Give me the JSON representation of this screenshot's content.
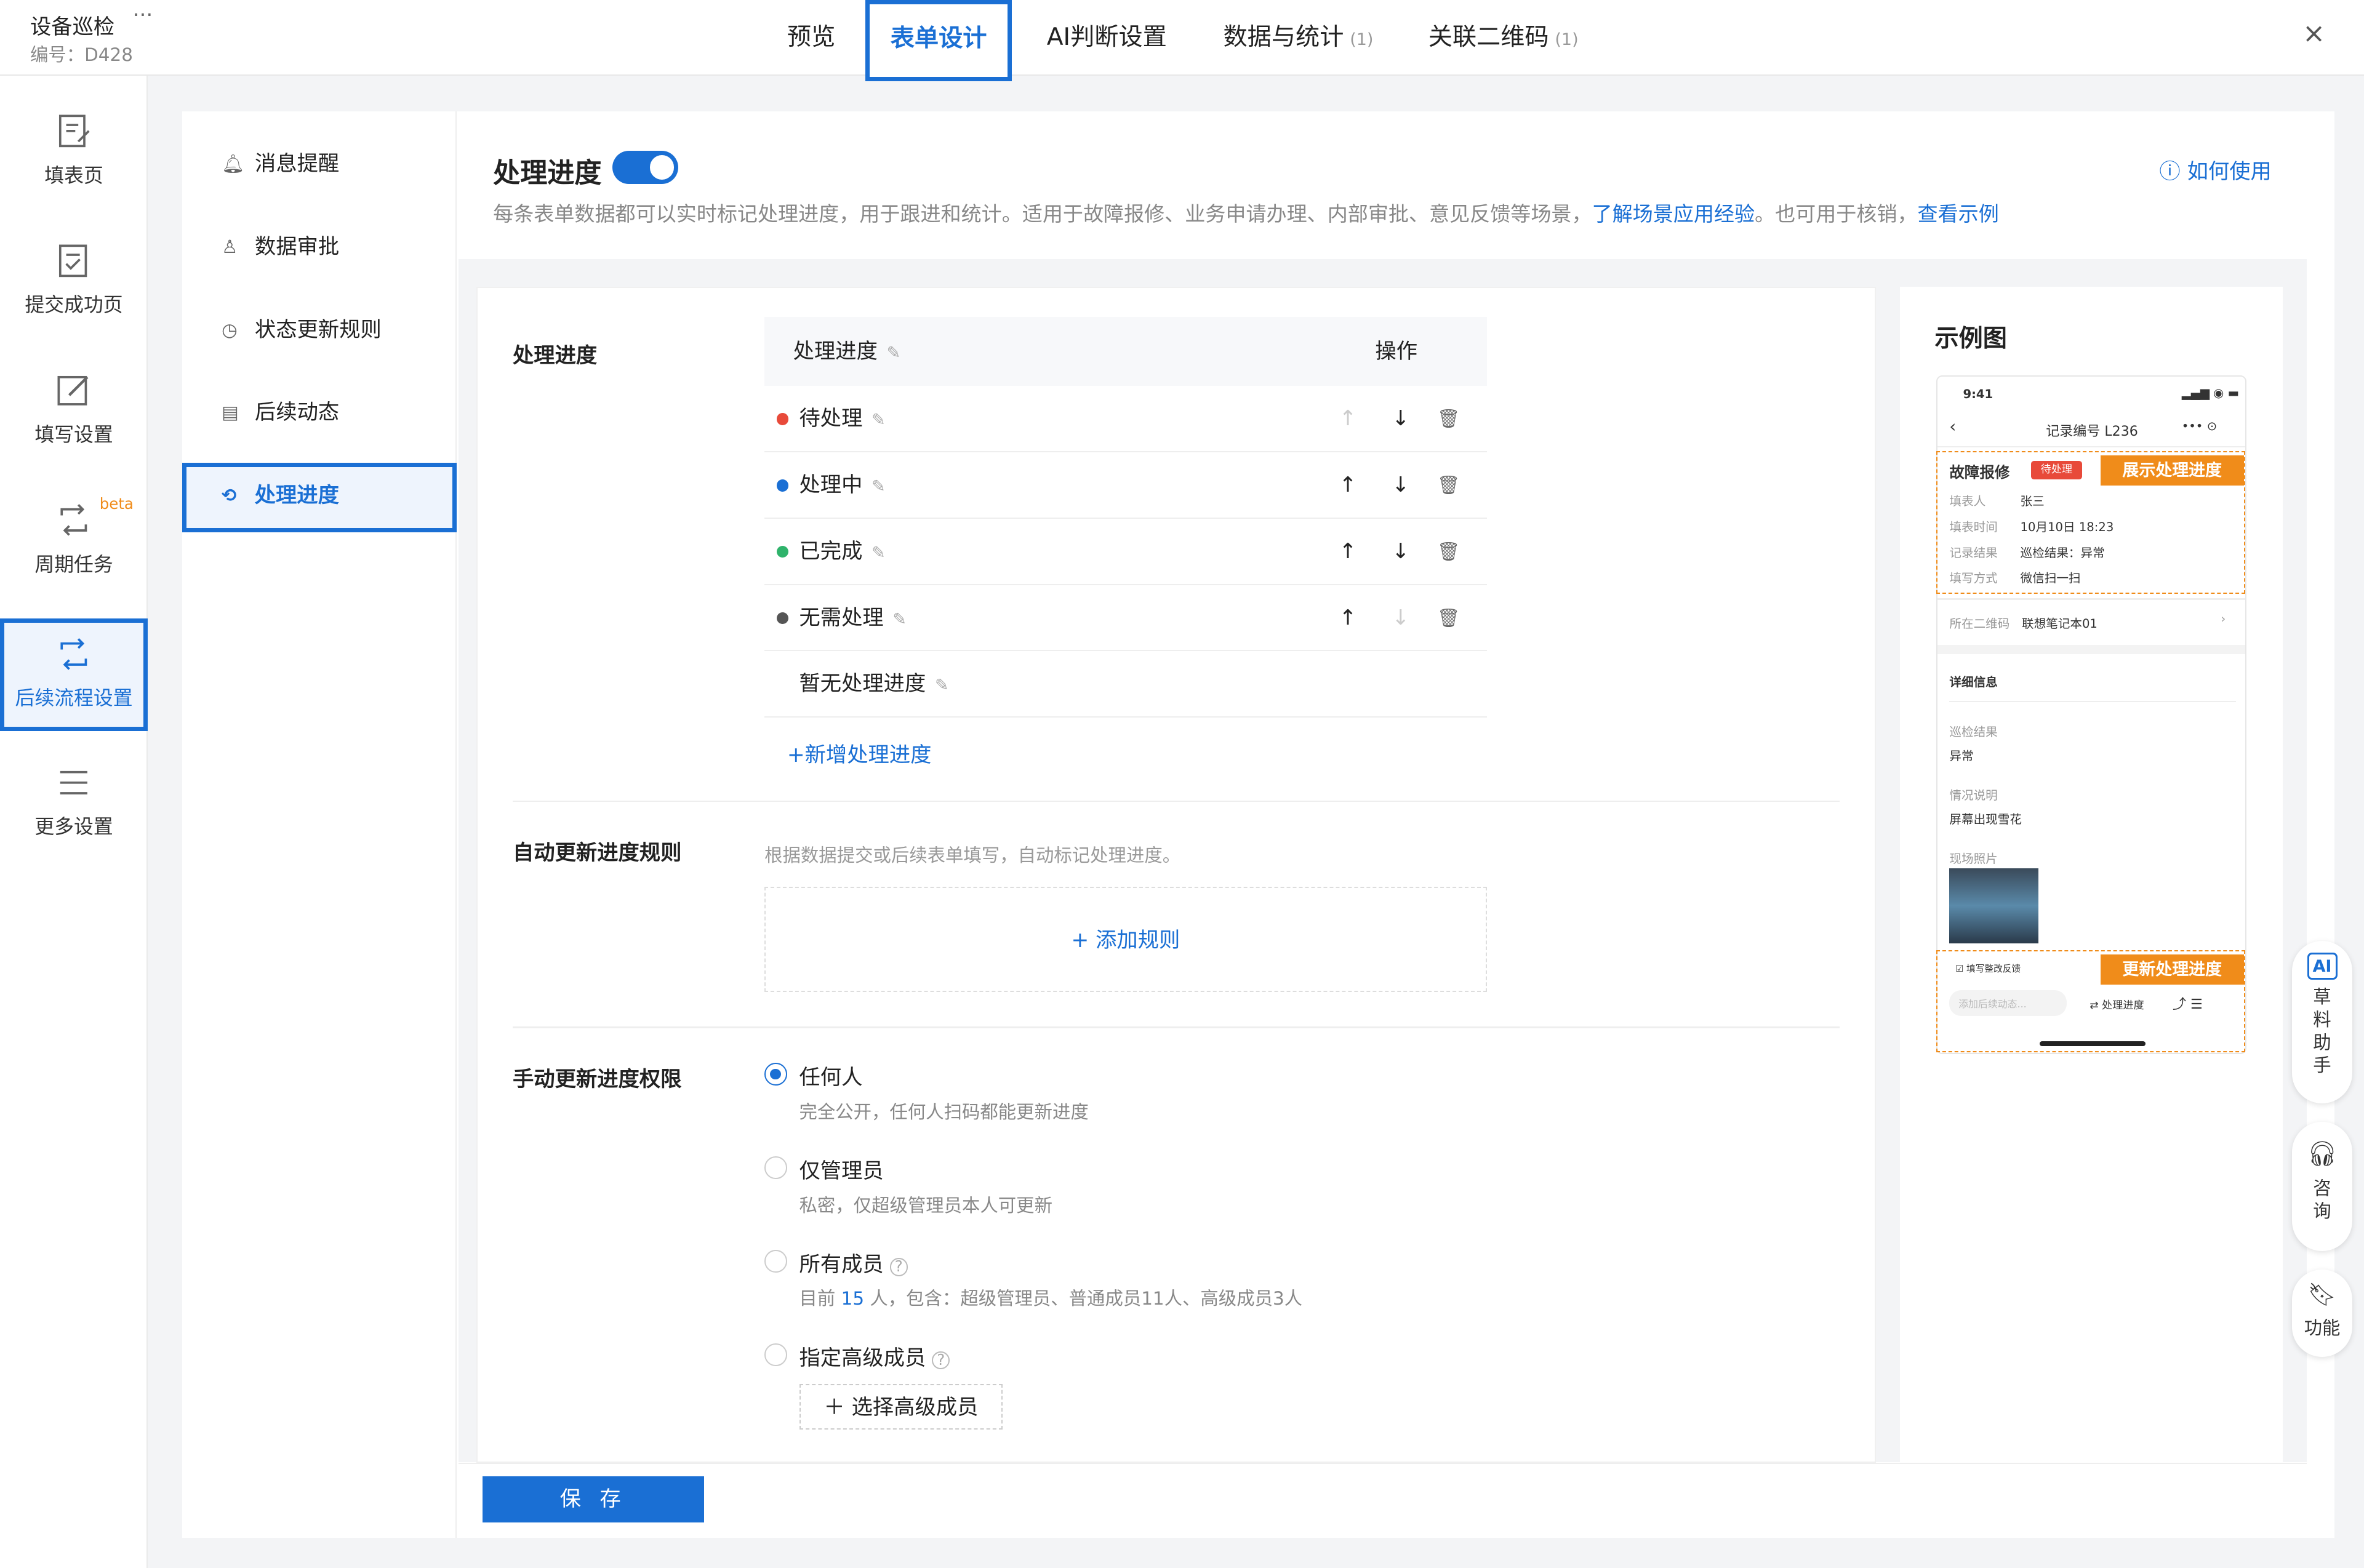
{
  "app": {
    "title": "设备巡检",
    "more": "···",
    "code": "编号：D428"
  },
  "tabs": [
    {
      "label": "预览",
      "count": ""
    },
    {
      "label": "表单设计",
      "count": ""
    },
    {
      "label": "AI判断设置",
      "count": ""
    },
    {
      "label": "数据与统计",
      "count": "(1)"
    },
    {
      "label": "关联二维码",
      "count": "(1)"
    }
  ],
  "close": "×",
  "leftnav": [
    {
      "label": "填表页"
    },
    {
      "label": "提交成功页"
    },
    {
      "label": "填写设置"
    },
    {
      "label": "周期任务",
      "badge": "beta"
    },
    {
      "label": "后续流程设置"
    },
    {
      "label": "更多设置"
    }
  ],
  "subnav": [
    {
      "label": "消息提醒",
      "icon": "bell-icon"
    },
    {
      "label": "数据审批",
      "icon": "stamp-icon"
    },
    {
      "label": "状态更新规则",
      "icon": "timer-icon"
    },
    {
      "label": "后续动态",
      "icon": "doc-icon"
    },
    {
      "label": "处理进度",
      "icon": "loop-icon"
    }
  ],
  "header": {
    "title": "处理进度",
    "howto": "如何使用",
    "desc_a": "每条表单数据都可以实时标记处理进度，用于跟进和统计。适用于故障报修、业务申请办理、内部审批、意见反馈等场景，",
    "desc_link1": "了解场景应用经验",
    "desc_b": "。也可用于核销，",
    "desc_link2": "查看示例"
  },
  "progress_section": {
    "label": "处理进度",
    "col_name": "处理进度",
    "col_op": "操作",
    "rows": [
      {
        "label": "待处理",
        "color": "#e84a3a"
      },
      {
        "label": "处理中",
        "color": "#1a6fd4"
      },
      {
        "label": "已完成",
        "color": "#2fb36b"
      },
      {
        "label": "无需处理",
        "color": "#555555"
      },
      {
        "label": "暂无处理进度",
        "color": ""
      }
    ],
    "add": "+新增处理进度"
  },
  "auto_section": {
    "label": "自动更新进度规则",
    "hint": "根据数据提交或后续表单填写，自动标记处理进度。",
    "add": "+ 添加规则"
  },
  "perm_section": {
    "label": "手动更新进度权限",
    "options": [
      {
        "label": "任何人",
        "sub": "完全公开，任何人扫码都能更新进度",
        "selected": true
      },
      {
        "label": "仅管理员",
        "sub": "私密，仅超级管理员本人可更新",
        "selected": false
      },
      {
        "label": "所有成员",
        "sub_a": "目前",
        "sub_num": "15",
        "sub_b": "人，包含：超级管理员、普通成员11人、高级成员3人",
        "selected": false
      },
      {
        "label": "指定高级成员",
        "selected": false
      }
    ],
    "select_btn": "选择高级成员"
  },
  "save": "保 存",
  "preview": {
    "title": "示例图",
    "time": "9:41",
    "record": "记录编号 L236",
    "card_title": "故障报修",
    "status_tag": "待处理",
    "show_tag": "展示处理进度",
    "fields": [
      {
        "k": "填表人",
        "v": "张三"
      },
      {
        "k": "填表时间",
        "v": "10月10日 18:23"
      },
      {
        "k": "记录结果",
        "v": "巡检结果：异常"
      },
      {
        "k": "填写方式",
        "v": "微信扫一扫"
      }
    ],
    "qr_k": "所在二维码",
    "qr_v": "联想笔记本01",
    "detail": "详细信息",
    "d1_k": "巡检结果",
    "d1_v": "异常",
    "d2_k": "情况说明",
    "d2_v": "屏幕出现雪花",
    "d3_k": "现场照片",
    "feedback": "填写整改反馈",
    "update_tag": "更新处理进度",
    "dynamic": "添加后续动态...",
    "progress_btn": "处理进度"
  },
  "float": {
    "ai": "草料助手",
    "consult": "咨询",
    "func": "功能"
  }
}
